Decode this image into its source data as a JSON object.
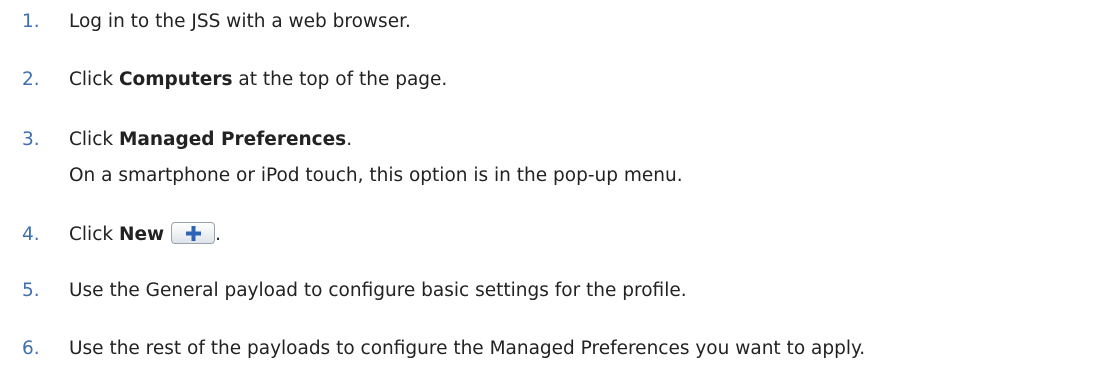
{
  "steps": [
    {
      "number": "1.",
      "text": "Log in to the JSS with a web browser."
    },
    {
      "number": "2.",
      "prefix": "Click ",
      "bold": "Computers",
      "suffix": " at the top of the page."
    },
    {
      "number": "3.",
      "prefix": "Click ",
      "bold": "Managed Preferences",
      "suffix": ".",
      "note": "On a smartphone or iPod touch, this option is in the pop-up menu."
    },
    {
      "number": "4.",
      "prefix": "Click ",
      "bold": "New",
      "suffix": ".",
      "icon": "plus-icon"
    },
    {
      "number": "5.",
      "text": "Use the General payload to configure basic settings for the profile."
    },
    {
      "number": "6.",
      "text": "Use the rest of the payloads to configure the Managed Preferences you want to apply."
    }
  ],
  "colors": {
    "number": "#3f6fb0",
    "text": "#222222",
    "icon": "#2e63b6"
  }
}
